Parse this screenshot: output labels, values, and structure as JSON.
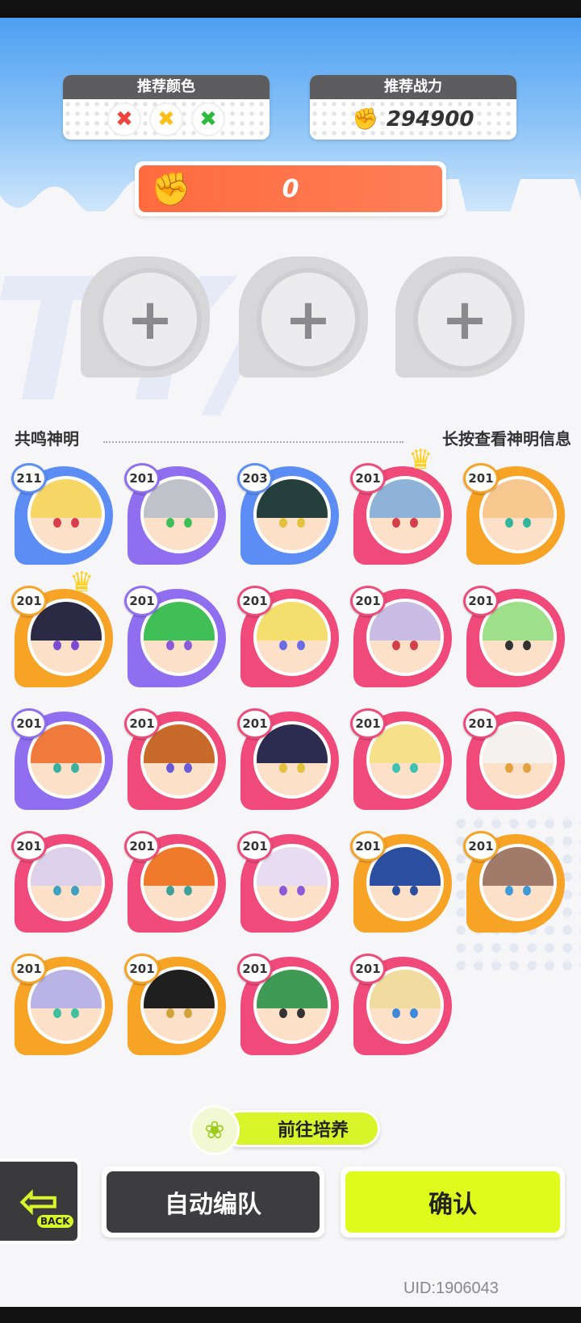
{
  "header": {
    "recommend_color": {
      "label": "推荐颜色",
      "colors": [
        {
          "name": "red",
          "color": "#f0453c",
          "glyph": "✖"
        },
        {
          "name": "yellow",
          "color": "#ffbf1a",
          "glyph": "✖"
        },
        {
          "name": "green",
          "color": "#2cbb3c",
          "glyph": "✖"
        }
      ]
    },
    "recommend_power": {
      "label": "推荐战力",
      "value": "294900",
      "icon": "fist-icon"
    },
    "team_power": {
      "value": "0",
      "icon": "fist-icon"
    }
  },
  "team_slots": [
    {
      "icon": "plus-icon",
      "glyph": "+"
    },
    {
      "icon": "plus-icon",
      "glyph": "+"
    },
    {
      "icon": "plus-icon",
      "glyph": "+"
    }
  ],
  "section": {
    "title": "共鸣神明",
    "hint": "长按查看神明信息"
  },
  "heroes": [
    {
      "level": "211",
      "ring": "#5b8df5",
      "hair": "#f6d765",
      "eye": "#d7404a",
      "crown": false
    },
    {
      "level": "201",
      "ring": "#8f6ef0",
      "hair": "#bfc3c9",
      "eye": "#3fbf5a",
      "crown": false
    },
    {
      "level": "203",
      "ring": "#5b8df5",
      "hair": "#25403c",
      "eye": "#e2c23d",
      "crown": false
    },
    {
      "level": "201",
      "ring": "#ef4a7a",
      "hair": "#8fb3d8",
      "eye": "#d2404a",
      "crown": true
    },
    {
      "level": "201",
      "ring": "#f6a326",
      "hair": "#f6c890",
      "eye": "#33b59a",
      "crown": false
    },
    {
      "level": "201",
      "ring": "#f6a326",
      "hair": "#2a2a45",
      "eye": "#7a4bd0",
      "crown": true
    },
    {
      "level": "201",
      "ring": "#8f6ef0",
      "hair": "#3fbf55",
      "eye": "#8a5ad8",
      "crown": false
    },
    {
      "level": "201",
      "ring": "#ef4a7a",
      "hair": "#f3de6e",
      "eye": "#6b6be8",
      "crown": false
    },
    {
      "level": "201",
      "ring": "#ef4a7a",
      "hair": "#c9bde6",
      "eye": "#d2404a",
      "crown": false
    },
    {
      "level": "201",
      "ring": "#ef4a7a",
      "hair": "#9ee08a",
      "eye": "#333333",
      "crown": false
    },
    {
      "level": "201",
      "ring": "#8f6ef0",
      "hair": "#f07a3c",
      "eye": "#3bb0a0",
      "crown": false
    },
    {
      "level": "201",
      "ring": "#ef4a7a",
      "hair": "#c86a2a",
      "eye": "#6a5ad8",
      "crown": false
    },
    {
      "level": "201",
      "ring": "#ef4a7a",
      "hair": "#2c2c50",
      "eye": "#e2c23d",
      "crown": false
    },
    {
      "level": "201",
      "ring": "#ef4a7a",
      "hair": "#f6e08a",
      "eye": "#3fc0b0",
      "crown": false
    },
    {
      "level": "201",
      "ring": "#ef4a7a",
      "hair": "#f4f1ee",
      "eye": "#e2a23d",
      "crown": false
    },
    {
      "level": "201",
      "ring": "#ef4a7a",
      "hair": "#dcd0ea",
      "eye": "#3fa0c0",
      "crown": false
    },
    {
      "level": "201",
      "ring": "#ef4a7a",
      "hair": "#f07a2c",
      "eye": "#3fa09a",
      "crown": false
    },
    {
      "level": "201",
      "ring": "#ef4a7a",
      "hair": "#e8dcf2",
      "eye": "#8a5ad8",
      "crown": false
    },
    {
      "level": "201",
      "ring": "#f6a326",
      "hair": "#2b4fa0",
      "eye": "#2b4fa0",
      "crown": false
    },
    {
      "level": "201",
      "ring": "#f6a326",
      "hair": "#a27a6a",
      "eye": "#3f9ad8",
      "crown": false
    },
    {
      "level": "201",
      "ring": "#f6a326",
      "hair": "#b9b3e6",
      "eye": "#3fbfa0",
      "crown": false
    },
    {
      "level": "201",
      "ring": "#f6a326",
      "hair": "#1f1f1f",
      "eye": "#d2a23d",
      "crown": false
    },
    {
      "level": "201",
      "ring": "#ef4a7a",
      "hair": "#3f9a55",
      "eye": "#333333",
      "crown": false
    },
    {
      "level": "201",
      "ring": "#ef4a7a",
      "hair": "#f1dca0",
      "eye": "#3f8ad8",
      "crown": false
    }
  ],
  "actions": {
    "train": "前往培养",
    "train_icon": "sprout-bird-icon",
    "back_label": "BACK",
    "back_icon": "back-arrow-icon",
    "auto": "自动编队",
    "confirm": "确认"
  },
  "uid": "UID:1906043"
}
